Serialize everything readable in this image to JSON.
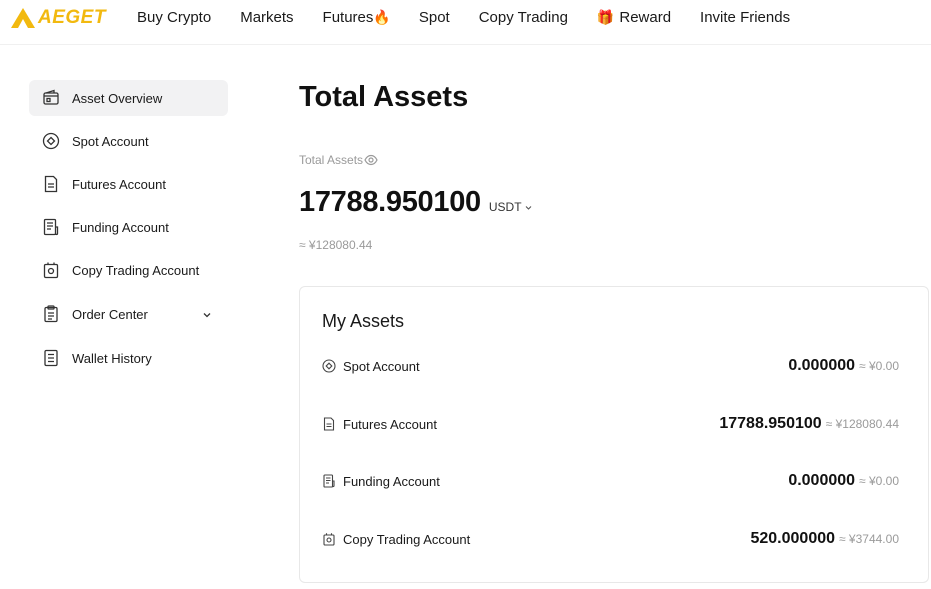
{
  "brand": {
    "name": "AEGET",
    "accent": "#f2b90f"
  },
  "nav": [
    {
      "label": "Buy Crypto"
    },
    {
      "label": "Markets"
    },
    {
      "label": "Futures",
      "emoji": "🔥"
    },
    {
      "label": "Spot"
    },
    {
      "label": "Copy Trading"
    },
    {
      "label": "Reward",
      "emoji_before": "🎁"
    },
    {
      "label": "Invite Friends"
    }
  ],
  "sidebar": {
    "items": [
      {
        "label": "Asset Overview",
        "icon": "wallet-icon",
        "active": true
      },
      {
        "label": "Spot Account",
        "icon": "spot-circle-icon"
      },
      {
        "label": "Futures Account",
        "icon": "document-icon"
      },
      {
        "label": "Funding Account",
        "icon": "ledger-icon"
      },
      {
        "label": "Copy Trading Account",
        "icon": "bag-icon"
      },
      {
        "label": "Order Center",
        "icon": "clipboard-icon",
        "expandable": true
      },
      {
        "label": "Wallet History",
        "icon": "history-list-icon"
      }
    ]
  },
  "main": {
    "title": "Total Assets",
    "total_label": "Total Assets",
    "total_value": "17788.950100",
    "currency": "USDT",
    "approx_fiat": "≈ ¥128080.44"
  },
  "my_assets": {
    "title": "My Assets",
    "rows": [
      {
        "label": "Spot Account",
        "icon": "spot-circle-icon",
        "amount": "0.000000",
        "fiat": "≈ ¥0.00"
      },
      {
        "label": "Futures Account",
        "icon": "document-icon",
        "amount": "17788.950100",
        "fiat": "≈ ¥128080.44"
      },
      {
        "label": "Funding Account",
        "icon": "ledger-icon",
        "amount": "0.000000",
        "fiat": "≈ ¥0.00"
      },
      {
        "label": "Copy Trading Account",
        "icon": "bag-icon",
        "amount": "520.000000",
        "fiat": "≈ ¥3744.00"
      }
    ]
  }
}
